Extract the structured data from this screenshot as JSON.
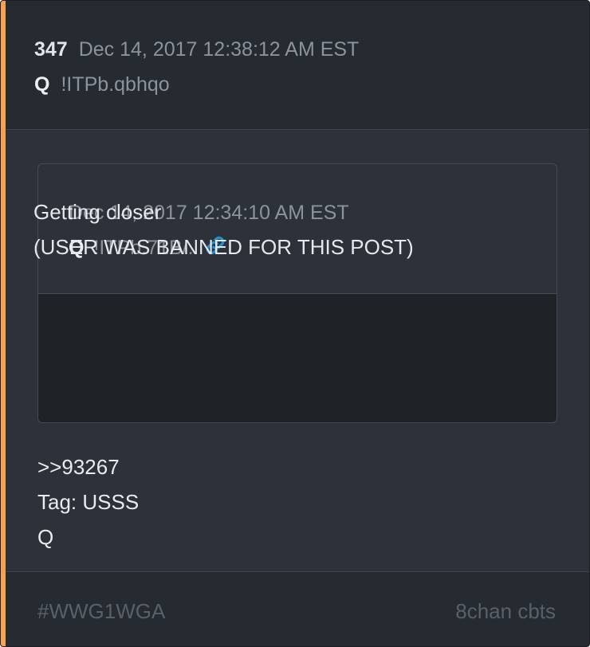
{
  "post": {
    "number": "347",
    "timestamp": "Dec 14, 2017 12:38:12 AM EST",
    "author": "Q",
    "tripcode": "!ITPb.qbhqo"
  },
  "quoted_post": {
    "timestamp": "Dec 14, 2017 12:34:10 AM EST",
    "author": "Q",
    "tripcode": "!ITPb.71B/.",
    "link_icon": "link-icon",
    "lines": [
      "Getting closer",
      "(USER WAS BANNED FOR THIS POST)"
    ]
  },
  "body": {
    "lines": [
      ">>93267",
      "Tag: USSS",
      "Q"
    ]
  },
  "footer": {
    "tag": "#WWG1WGA",
    "source": "8chan cbts"
  },
  "colors": {
    "accent": "#f7a34b",
    "link": "#1e8fd8"
  }
}
